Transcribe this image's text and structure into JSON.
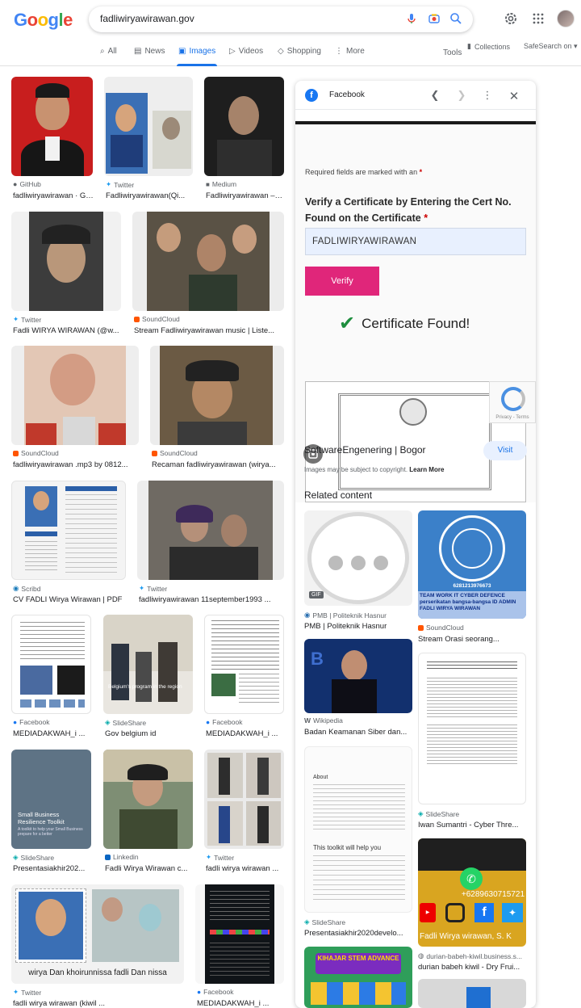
{
  "header": {
    "search_query": "fadliwiryawirawan.gov",
    "tabs": [
      "All",
      "News",
      "Images",
      "Videos",
      "Shopping",
      "More"
    ],
    "active_tab": "Images",
    "tools": "Tools",
    "collections": "Collections",
    "safesearch": "SafeSearch on"
  },
  "results": [
    {
      "source": "GitHub",
      "title": "fadliwiryawirawan · GitHub"
    },
    {
      "source": "Twitter",
      "title": "Fadliwiryawirawan(Qi..."
    },
    {
      "source": "Medium",
      "title": "Fadliwiryawirawan – Medium"
    },
    {
      "source": "Twitter",
      "title": "Fadli WIRYA WIRAWAN (@w..."
    },
    {
      "source": "SoundCloud",
      "title": "Stream Fadliwiryawirawan music | Liste..."
    },
    {
      "source": "SoundCloud",
      "title": "fadliwiryawirawan .mp3 by 0812..."
    },
    {
      "source": "SoundCloud",
      "title": "Recaman fadliwiryawirawan (wirya..."
    },
    {
      "source": "Scribd",
      "title": "CV FADLI Wirya Wirawan | PDF"
    },
    {
      "source": "Twitter",
      "title": "fadliwiryawirawan 11september1993 ..."
    },
    {
      "source": "Facebook",
      "title": "MEDIADAKWAH_i ..."
    },
    {
      "source": "SlideShare",
      "title": "Gov belgium id"
    },
    {
      "source": "Facebook",
      "title": "MEDIADAKWAH_i ..."
    },
    {
      "source": "SlideShare",
      "title": "Presentasiakhir202..."
    },
    {
      "source": "Linkedin",
      "title": "Fadli Wirya Wirawan c..."
    },
    {
      "source": "Twitter",
      "title": "fadli wirya wirawan ..."
    },
    {
      "source": "Twitter",
      "title": "fadli wirya wirawan (kiwil ..."
    },
    {
      "source": "Facebook",
      "title": "MEDIADAKWAH_i ..."
    }
  ],
  "thumb_text": {
    "slide_title": "Small Business Resilience Toolkit",
    "slide_sub": "A toolkit to help your Small Business prepare for a better",
    "names_caption": "wirya Dan khoirunnissa  fadli  Dan nissa",
    "gov_caption": "Belgium's program in the region"
  },
  "panel": {
    "source": "Facebook",
    "required_note": "Required fields are marked with an",
    "required_mark": "*",
    "verify_heading": "Verify a Certificate by Entering the Cert No. Found on the Certificate",
    "cert_value": "FADLIWIRYAWIRAWAN",
    "verify_button": "Verify",
    "certificate_found": "Certificate Found!",
    "recaptcha_text": "Privacy - Terms",
    "site_name": "SoftwareEngenering | Bogor",
    "visit": "Visit",
    "copyright": "Images may be subject to copyright.",
    "learn_more": "Learn More",
    "related_heading": "Related content",
    "related": [
      {
        "source": "PMB | Politeknik Hasnur",
        "title": "PMB | Politeknik Hasnur",
        "badge": "GIF"
      },
      {
        "source": "SoundCloud",
        "title": "Stream Orasi seorang..."
      },
      {
        "source": "Wikipedia",
        "title": "Badan Keamanan Siber dan..."
      },
      {
        "source": "SlideShare",
        "title": "Iwan Sumantri - Cyber Thre..."
      },
      {
        "source": "SlideShare",
        "title": "Presentasiakhir2020develo..."
      },
      {
        "source": "durian-babeh-kiwil.business.s...",
        "title": "durian babeh kiwil - Dry Frui..."
      }
    ],
    "related_text": {
      "un_caption": "TEAM WORK IT CYBER DEFENCE perserikatan bangsa-bangsa ID ADMIN FADLI WIRYA WIRAWAN",
      "un_phone": "6281213976673",
      "wa_phone": "+6289630715721",
      "wa_name": "Fadli Wirya wirawan, S. K",
      "doc_about": "About",
      "doc_help": "This toolkit will help you",
      "stem": "KIHAJAR STEM ADVANCE"
    }
  },
  "colors": {
    "accent": "#1a73e8",
    "verify_button": "#e0267a",
    "check": "#1e8e3e"
  }
}
